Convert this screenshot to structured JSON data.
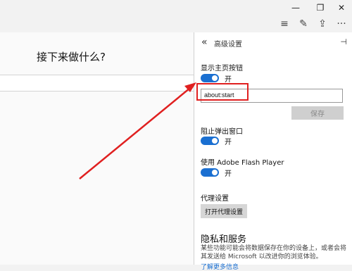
{
  "window": {
    "minimize_icon": "—",
    "restore_icon": "❐",
    "close_icon": "✕"
  },
  "toolbar": {
    "menu_icon": "≡",
    "note_icon": "✎",
    "share_icon": "⇪",
    "more_icon": "···"
  },
  "main": {
    "headline": "接下来做什么?"
  },
  "panel": {
    "back_icon": "«",
    "title": "高级设置",
    "pin_icon": "⊣",
    "home_button": {
      "label": "显示主页按钮",
      "state": "开",
      "url": "about:start",
      "save_label": "保存"
    },
    "popup_block": {
      "label": "阻止弹出窗口",
      "state": "开"
    },
    "flash": {
      "label": "使用 Adobe Flash Player",
      "state": "开"
    },
    "proxy": {
      "label": "代理设置",
      "button": "打开代理设置"
    },
    "privacy": {
      "title": "隐私和服务",
      "description": "某些功能可能会将数据保存在你的设备上，或者会将其发送给 Microsoft 以改进你的浏览体验。",
      "link": "了解更多信息"
    }
  },
  "colors": {
    "toggle_on": "#1a6fd1",
    "annotation": "#e02020"
  }
}
